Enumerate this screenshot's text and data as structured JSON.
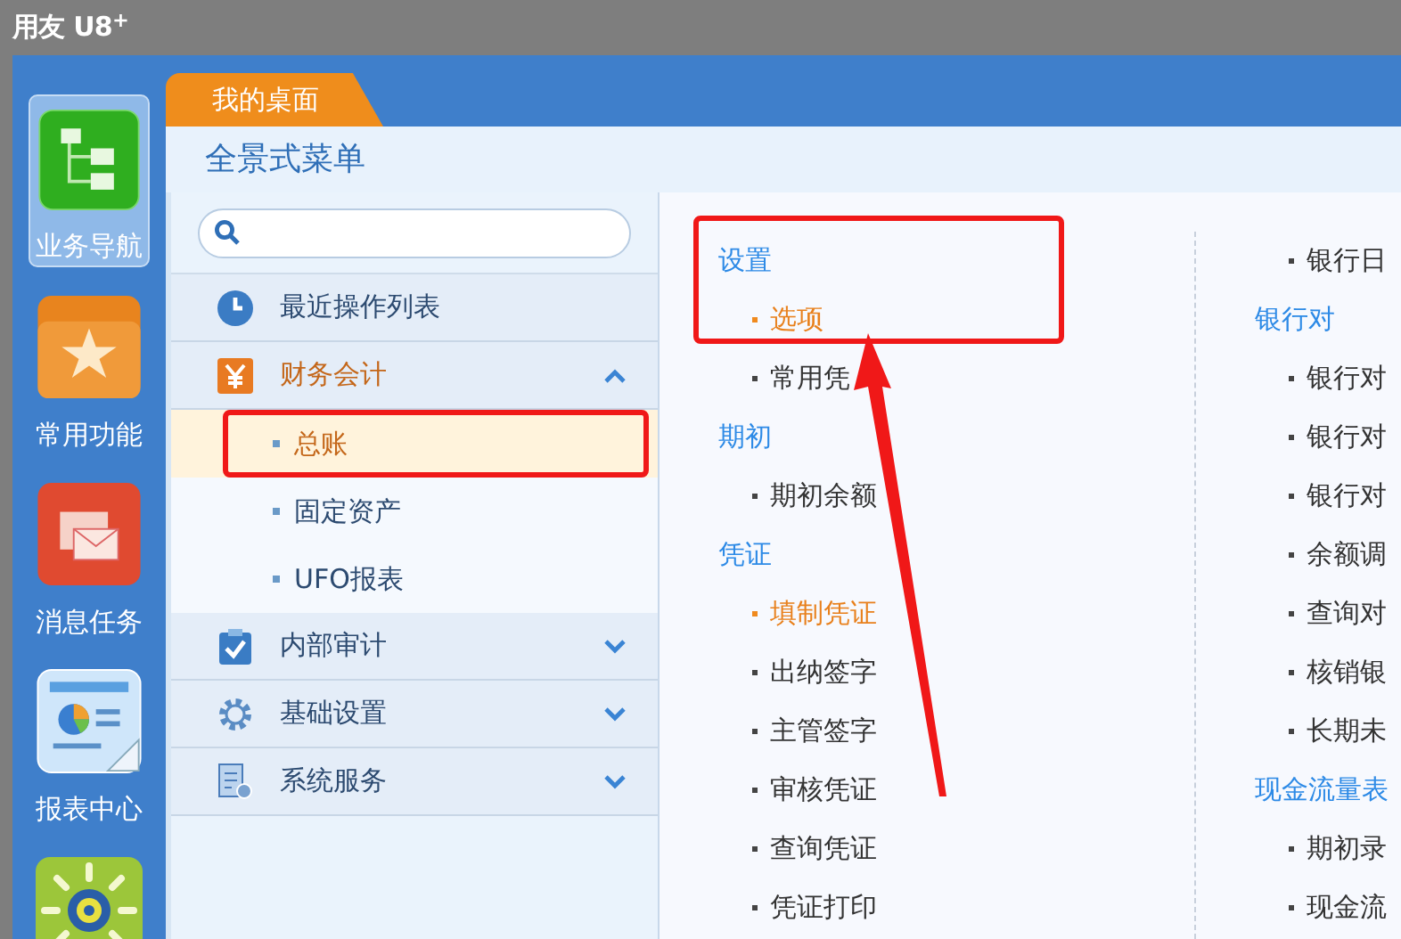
{
  "app_title": "用友 U8$^{+}$",
  "rail": [
    {
      "kind": "tree",
      "label": "业务导航",
      "selected": true
    },
    {
      "kind": "star",
      "label": "常用功能",
      "selected": false
    },
    {
      "kind": "mail",
      "label": "消息任务",
      "selected": false
    },
    {
      "kind": "report",
      "label": "报表中心",
      "selected": false
    },
    {
      "kind": "gear",
      "selected": false
    }
  ],
  "tab": {
    "label": "我的桌面",
    "selected": true
  },
  "panel_title": "全景式菜单",
  "nav": [
    {
      "kind": "clock",
      "label": "最近操作列表"
    },
    {
      "kind": "yen",
      "label": "财务会计",
      "expanded": true,
      "children": [
        {
          "label": "总账",
          "selected": true
        },
        {
          "label": "固定资产",
          "selected": false
        },
        {
          "label": "UFO报表",
          "selected": false
        }
      ]
    },
    {
      "kind": "clipboard",
      "label": "内部审计",
      "expanded": false
    },
    {
      "kind": "gear",
      "label": "基础设置",
      "expanded": false
    },
    {
      "kind": "server",
      "label": "系统服务",
      "expanded": false
    }
  ],
  "menu_columns": [
    {
      "groups": [
        {
          "heading": "设置",
          "items": [
            {
              "label": "选项",
              "highlighted": true
            },
            {
              "label": "常用凭",
              "highlighted": false
            }
          ]
        },
        {
          "heading": "期初",
          "items": [
            {
              "label": "期初余额",
              "highlighted": false
            }
          ]
        },
        {
          "heading": "凭证",
          "items": [
            {
              "label": "填制凭证",
              "highlighted": true
            },
            {
              "label": "出纳签字",
              "highlighted": false
            },
            {
              "label": "主管签字",
              "highlighted": false
            },
            {
              "label": "审核凭证",
              "highlighted": false
            },
            {
              "label": "查询凭证",
              "highlighted": false
            },
            {
              "label": "凭证打印",
              "highlighted": false
            }
          ]
        }
      ]
    },
    {
      "groups": [
        {
          "items": [
            {
              "label": "银行日",
              "highlighted": false
            }
          ]
        },
        {
          "heading": "银行对",
          "items": [
            {
              "label": "银行对",
              "highlighted": false
            },
            {
              "label": "银行对",
              "highlighted": false
            },
            {
              "label": "银行对",
              "highlighted": false
            },
            {
              "label": "余额调",
              "highlighted": false
            },
            {
              "label": "查询对",
              "highlighted": false
            },
            {
              "label": "核销银",
              "highlighted": false
            },
            {
              "label": "长期未",
              "highlighted": false
            }
          ]
        },
        {
          "heading": "现金流量表",
          "items": [
            {
              "label": "期初录",
              "highlighted": false
            },
            {
              "label": "现金流",
              "highlighted": false
            }
          ]
        }
      ]
    }
  ]
}
